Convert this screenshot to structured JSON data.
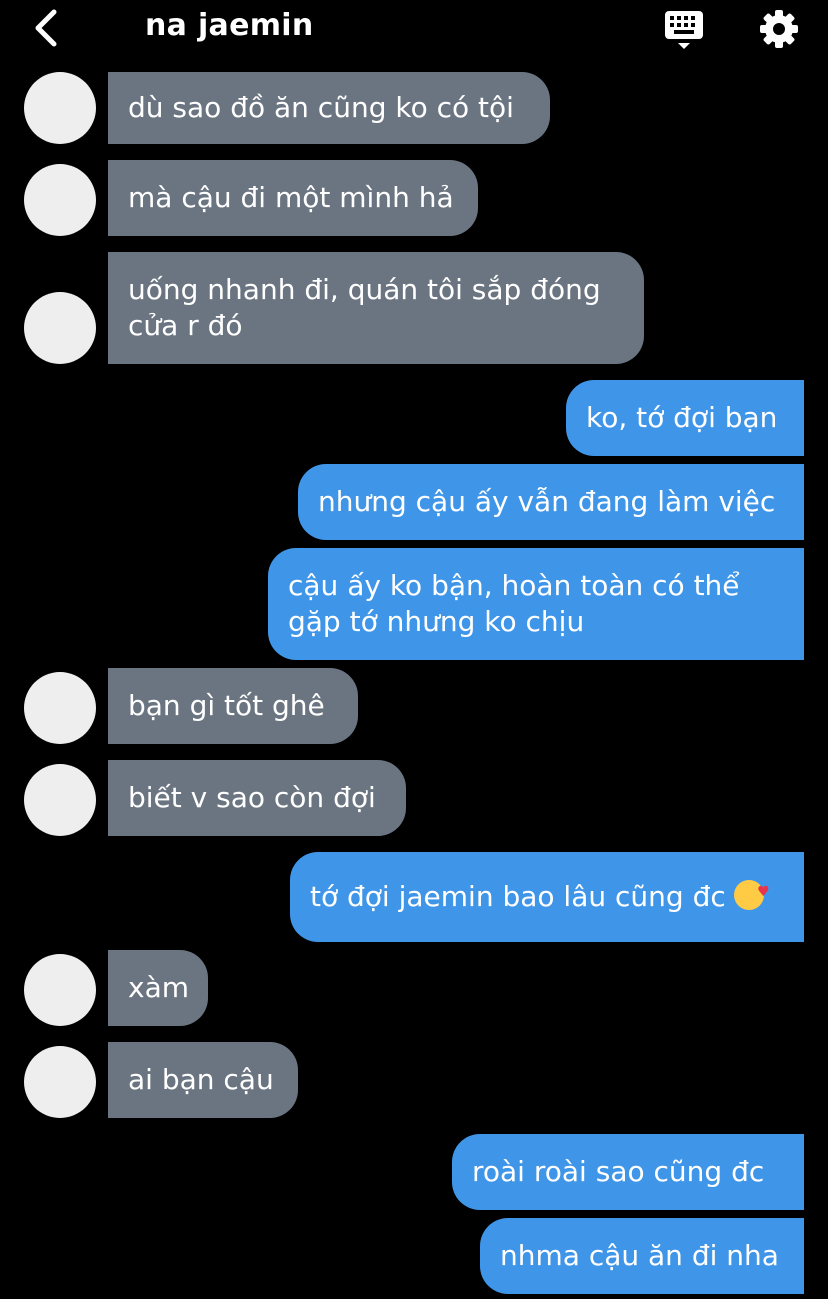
{
  "header": {
    "title": "na jaemin"
  },
  "messages": [
    {
      "from": "them",
      "text": "dù sao đồ ăn cũng ko có tội"
    },
    {
      "from": "them",
      "text": "mà cậu đi một mình hả"
    },
    {
      "from": "them",
      "text": "uống nhanh đi, quán tôi sắp đóng",
      "text2": "cửa r đó"
    },
    {
      "from": "me",
      "text": "ko, tớ đợi bạn"
    },
    {
      "from": "me",
      "text": "nhưng cậu ấy vẫn đang làm việc"
    },
    {
      "from": "me",
      "text": "cậu ấy ko bận, hoàn toàn có thể",
      "text2": "gặp tớ nhưng ko chịu"
    },
    {
      "from": "them",
      "text": "bạn gì tốt ghê"
    },
    {
      "from": "them",
      "text": "biết v sao còn đợi"
    },
    {
      "from": "me",
      "text": "tớ đợi jaemin bao lâu cũng đc",
      "emoji": "smiling-face-with-hearts"
    },
    {
      "from": "them",
      "text": "xàm"
    },
    {
      "from": "them",
      "text": "ai bạn cậu"
    },
    {
      "from": "me",
      "text": "roài roài sao cũng đc"
    },
    {
      "from": "me",
      "text": "nhma cậu ăn đi nha"
    }
  ],
  "colors": {
    "incoming_bubble": "#6b7581",
    "outgoing_bubble": "#3f95e8",
    "background": "#000000"
  }
}
